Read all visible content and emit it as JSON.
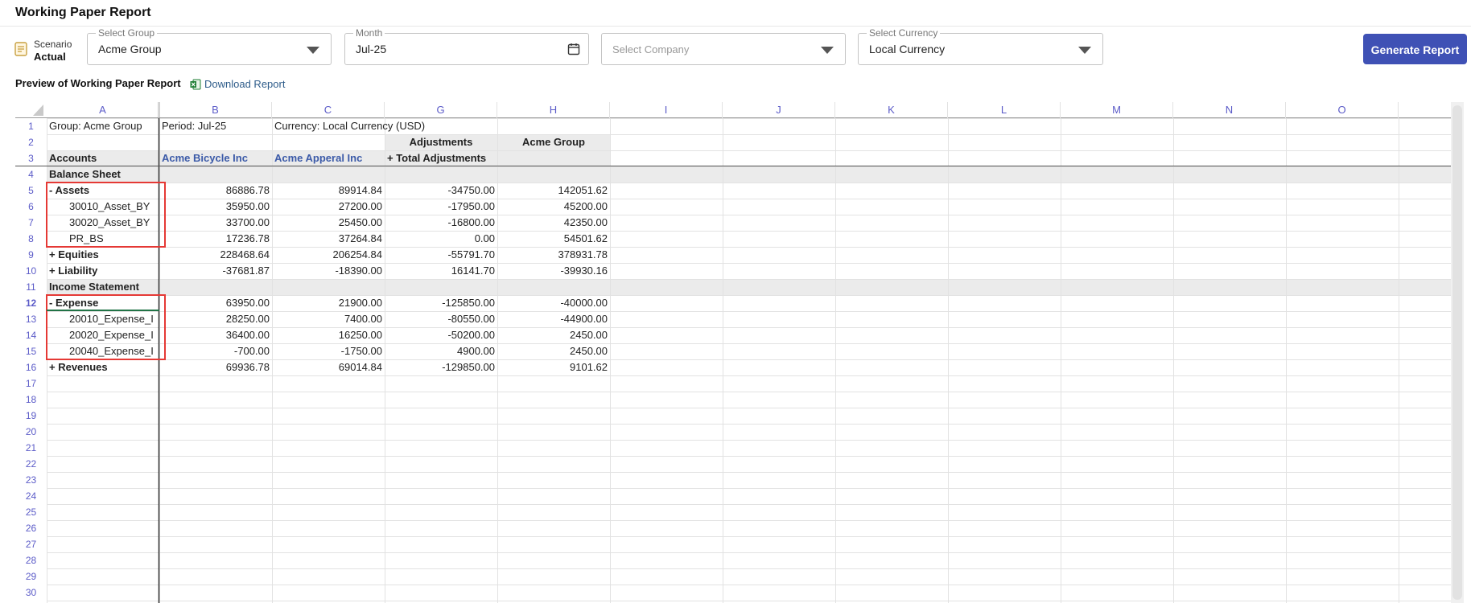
{
  "page": {
    "title": "Working Paper Report"
  },
  "scenario": {
    "label": "Scenario",
    "value": "Actual",
    "icon": "report-icon"
  },
  "filters": {
    "group": {
      "legend": "Select Group",
      "value": "Acme Group"
    },
    "month": {
      "legend": "Month",
      "value": "Jul-25"
    },
    "company": {
      "placeholder": "Select Company"
    },
    "currency": {
      "legend": "Select Currency",
      "value": "Local Currency"
    }
  },
  "actions": {
    "generate": "Generate Report",
    "download": "Download Report"
  },
  "preview": {
    "title": "Preview of Working Paper Report"
  },
  "colors": {
    "accent": "#3f51b5",
    "highlight": "#e53935",
    "header_text": "#5b5bc8",
    "company_text": "#3b5aa8"
  },
  "sheet": {
    "columns": [
      "A",
      "B",
      "C",
      "G",
      "H",
      "I",
      "J",
      "K",
      "L",
      "M",
      "N",
      "O"
    ],
    "row_numbers": [
      "1",
      "2",
      "3",
      "4",
      "5",
      "6",
      "7",
      "8",
      "9",
      "10",
      "11",
      "12",
      "13",
      "14",
      "15",
      "16",
      "17",
      "18",
      "19",
      "20",
      "21",
      "22",
      "23",
      "24",
      "25",
      "26",
      "27",
      "28",
      "29",
      "30"
    ],
    "header_row1": [
      "Group: Acme Group",
      "Period: Jul-25",
      "Currency: Local Currency (USD)"
    ],
    "header_row2": {
      "g": "Adjustments",
      "h": "Acme Group"
    },
    "header_row3": {
      "a": "Accounts",
      "b": "Acme Bicycle Inc",
      "c": "Acme Apperal Inc",
      "g": "+  Total Adjustments"
    },
    "rows": [
      {
        "type": "section",
        "a": "Balance Sheet"
      },
      {
        "type": "group",
        "a": "- Assets",
        "b": "86886.78",
        "c": "89914.84",
        "g": "-34750.00",
        "h": "142051.62"
      },
      {
        "type": "child",
        "a": "30010_Asset_BY",
        "b": "35950.00",
        "c": "27200.00",
        "g": "-17950.00",
        "h": "45200.00"
      },
      {
        "type": "child",
        "a": "30020_Asset_BY",
        "b": "33700.00",
        "c": "25450.00",
        "g": "-16800.00",
        "h": "42350.00"
      },
      {
        "type": "child",
        "a": "PR_BS",
        "b": "17236.78",
        "c": "37264.84",
        "g": "0.00",
        "h": "54501.62"
      },
      {
        "type": "group",
        "a": "+ Equities",
        "b": "228468.64",
        "c": "206254.84",
        "g": "-55791.70",
        "h": "378931.78"
      },
      {
        "type": "group",
        "a": "+ Liability",
        "b": "-37681.87",
        "c": "-18390.00",
        "g": "16141.70",
        "h": "-39930.16"
      },
      {
        "type": "section",
        "a": "Income Statement"
      },
      {
        "type": "group",
        "a": "- Expense",
        "b": "63950.00",
        "c": "21900.00",
        "g": "-125850.00",
        "h": "-40000.00"
      },
      {
        "type": "child",
        "a": "20010_Expense_I",
        "b": "28250.00",
        "c": "7400.00",
        "g": "-80550.00",
        "h": "-44900.00"
      },
      {
        "type": "child",
        "a": "20020_Expense_I",
        "b": "36400.00",
        "c": "16250.00",
        "g": "-50200.00",
        "h": "2450.00"
      },
      {
        "type": "child",
        "a": "20040_Expense_I",
        "b": "-700.00",
        "c": "-1750.00",
        "g": "4900.00",
        "h": "2450.00"
      },
      {
        "type": "group",
        "a": "+ Revenues",
        "b": "69936.78",
        "c": "69014.84",
        "g": "-129850.00",
        "h": "9101.62"
      }
    ]
  }
}
